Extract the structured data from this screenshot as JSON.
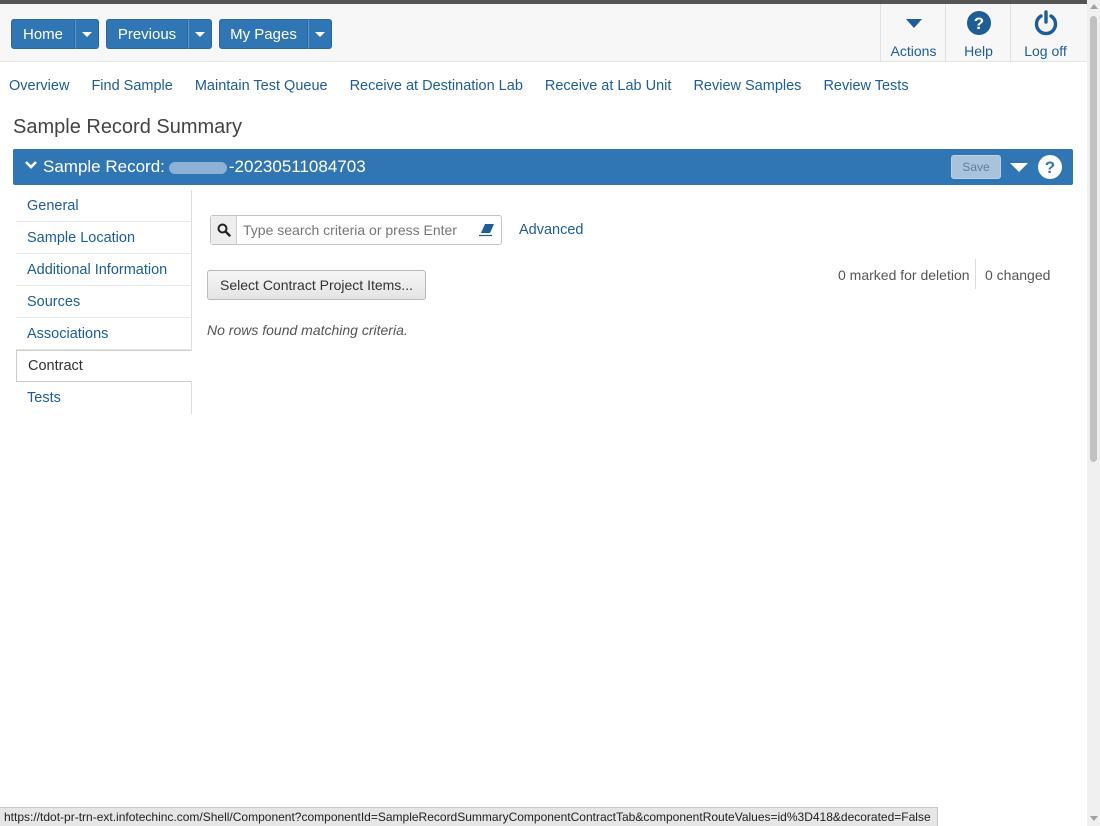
{
  "colors": {
    "primary": "#3176b4",
    "link": "#1e5d96"
  },
  "topbar": {
    "home": {
      "label": "Home"
    },
    "previous": {
      "label": "Previous"
    },
    "my_pages": {
      "label": "My Pages"
    },
    "actions": {
      "label": "Actions",
      "icon": "caret-down-icon"
    },
    "help": {
      "label": "Help",
      "icon": "question-circle-icon"
    },
    "logoff": {
      "label": "Log off",
      "icon": "power-icon"
    }
  },
  "nav": {
    "links": [
      "Overview",
      "Find Sample",
      "Maintain Test Queue",
      "Receive at Destination Lab",
      "Receive at Lab Unit",
      "Review Samples",
      "Review Tests"
    ]
  },
  "page": {
    "title": "Sample Record Summary"
  },
  "panel": {
    "title_prefix": "Sample Record:",
    "record_suffix": "-20230511084703",
    "save_label": "Save"
  },
  "sidebar": {
    "items": [
      "General",
      "Sample Location",
      "Additional Information",
      "Sources",
      "Associations",
      "Contract",
      "Tests"
    ],
    "active": "Contract"
  },
  "search": {
    "placeholder": "Type search criteria or press Enter",
    "value": "",
    "advanced_label": "Advanced"
  },
  "contract": {
    "select_button": "Select Contract Project Items...",
    "marked_for_deletion": "0 marked for deletion",
    "changed": "0 changed",
    "empty_message": "No rows found matching criteria."
  },
  "statusbar": {
    "url": "https://tdot-pr-trn-ext.infotechinc.com/Shell/Component?componentId=SampleRecordSummaryComponentContractTab&componentRouteValues=id%3D418&decorated=False"
  }
}
